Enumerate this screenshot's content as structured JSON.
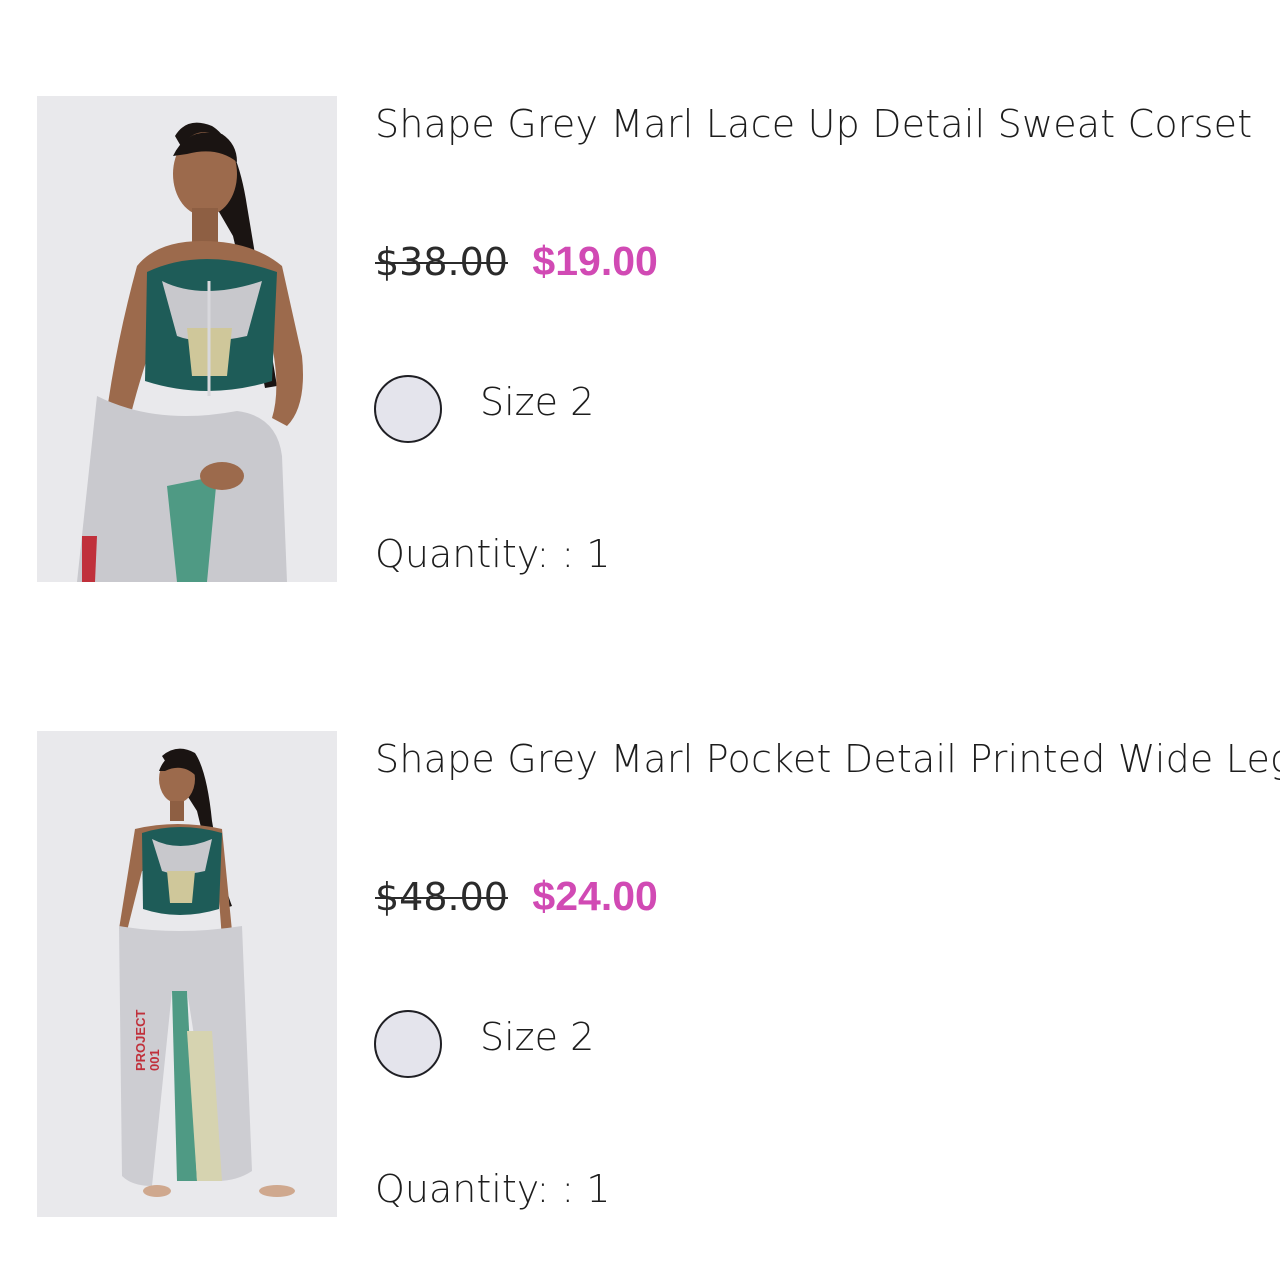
{
  "cart": {
    "items": [
      {
        "title": "Shape Grey Marl Lace Up Detail Sweat Corset",
        "original_price": "$38.00",
        "sale_price": "$19.00",
        "size": "Size 2",
        "quantity": "Quantity: : 1",
        "image_alt": "product-photo-corset"
      },
      {
        "title": "Shape Grey Marl Pocket Detail Printed Wide Leg Sw",
        "original_price": "$48.00",
        "sale_price": "$24.00",
        "size": "Size 2",
        "quantity": "Quantity: : 1",
        "image_alt": "product-photo-joggers",
        "image_print_text": "PROJECT 001"
      }
    ]
  },
  "colors": {
    "sale_price": "#d14ab4",
    "swatch_grey_marl": "#e4e4ec",
    "image_background": "#e9e9ec"
  }
}
